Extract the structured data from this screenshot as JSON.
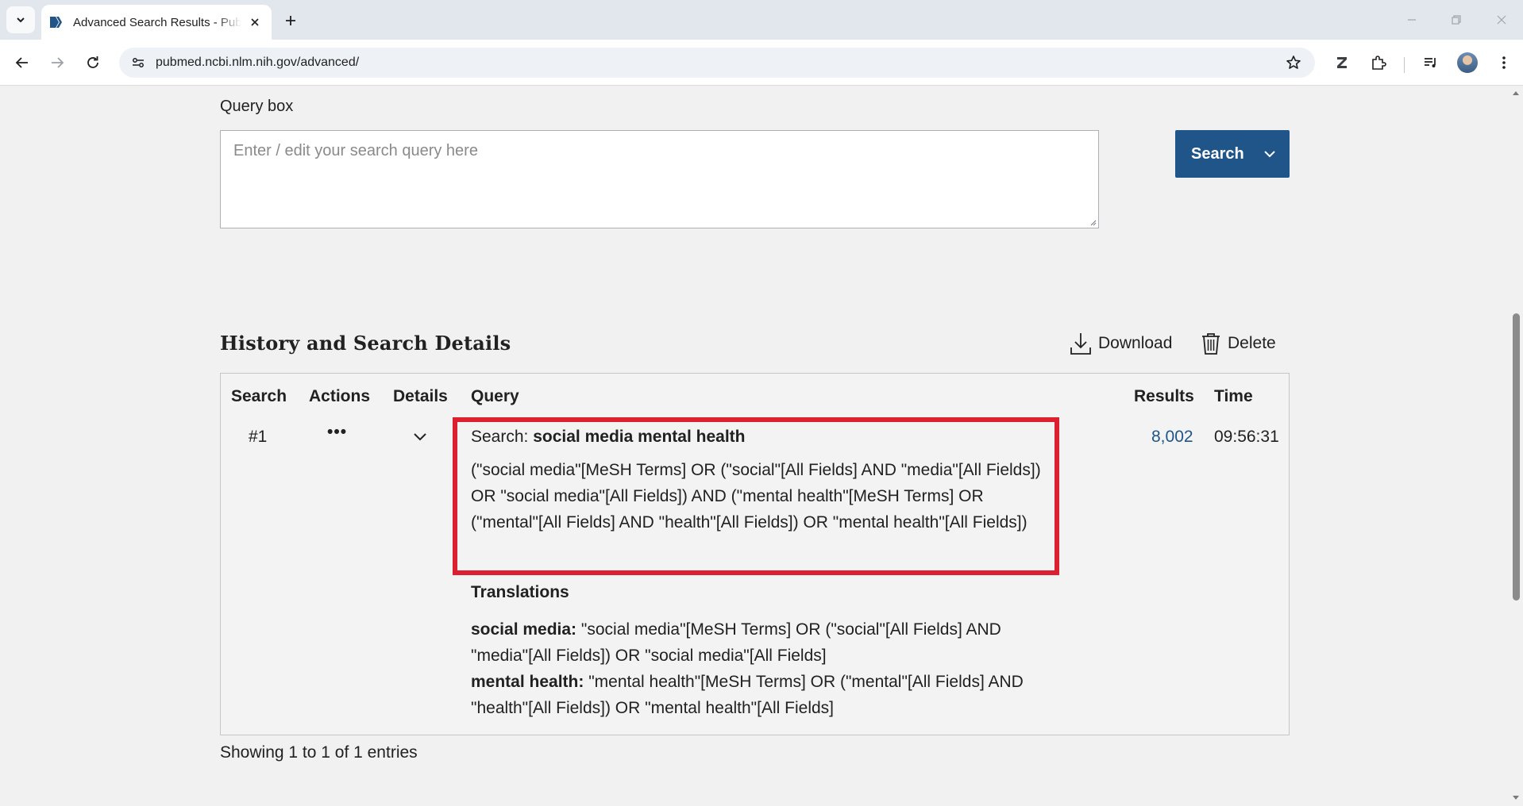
{
  "browser": {
    "tab_title": "Advanced Search Results - PubMed",
    "url": "pubmed.ncbi.nlm.nih.gov/advanced/"
  },
  "query_box": {
    "label": "Query box",
    "placeholder": "Enter / edit your search query here",
    "value": "",
    "search_button_label": "Search"
  },
  "history": {
    "title": "History and Search Details",
    "download_label": "Download",
    "delete_label": "Delete",
    "columns": [
      "Search",
      "Actions",
      "Details",
      "Query",
      "Results",
      "Time"
    ],
    "rows": [
      {
        "number": "#1",
        "actions_glyph": "•••",
        "search_prefix": "Search: ",
        "search_terms": "social media mental health",
        "query_string": "(\"social media\"[MeSH Terms] OR (\"social\"[All Fields] AND \"media\"[All Fields]) OR \"social media\"[All Fields]) AND (\"mental health\"[MeSH Terms] OR (\"mental\"[All Fields] AND \"health\"[All Fields]) OR \"mental health\"[All Fields])",
        "translations_heading": "Translations",
        "translations": [
          {
            "term": "social media:",
            "text": " \"social media\"[MeSH Terms] OR (\"social\"[All Fields] AND \"media\"[All Fields]) OR \"social media\"[All Fields]"
          },
          {
            "term": "mental health:",
            "text": " \"mental health\"[MeSH Terms] OR (\"mental\"[All Fields] AND \"health\"[All Fields]) OR \"mental health\"[All Fields]"
          }
        ],
        "results": "8,002",
        "time": "09:56:31"
      }
    ],
    "showing_text": "Showing 1 to 1 of 1 entries"
  },
  "colors": {
    "accent": "#20558a",
    "highlight_border": "#dc2030",
    "page_bg": "#f1f1f1"
  },
  "icons": [
    "chevron-down-icon",
    "pubmed-favicon-icon",
    "close-icon",
    "plus-icon",
    "minimize-icon",
    "restore-icon",
    "back-arrow-icon",
    "forward-arrow-icon",
    "reload-icon",
    "site-info-icon",
    "star-icon",
    "zotero-icon",
    "extensions-icon",
    "media-control-icon",
    "kebab-menu-icon",
    "download-icon",
    "trash-icon",
    "ellipsis-icon"
  ]
}
